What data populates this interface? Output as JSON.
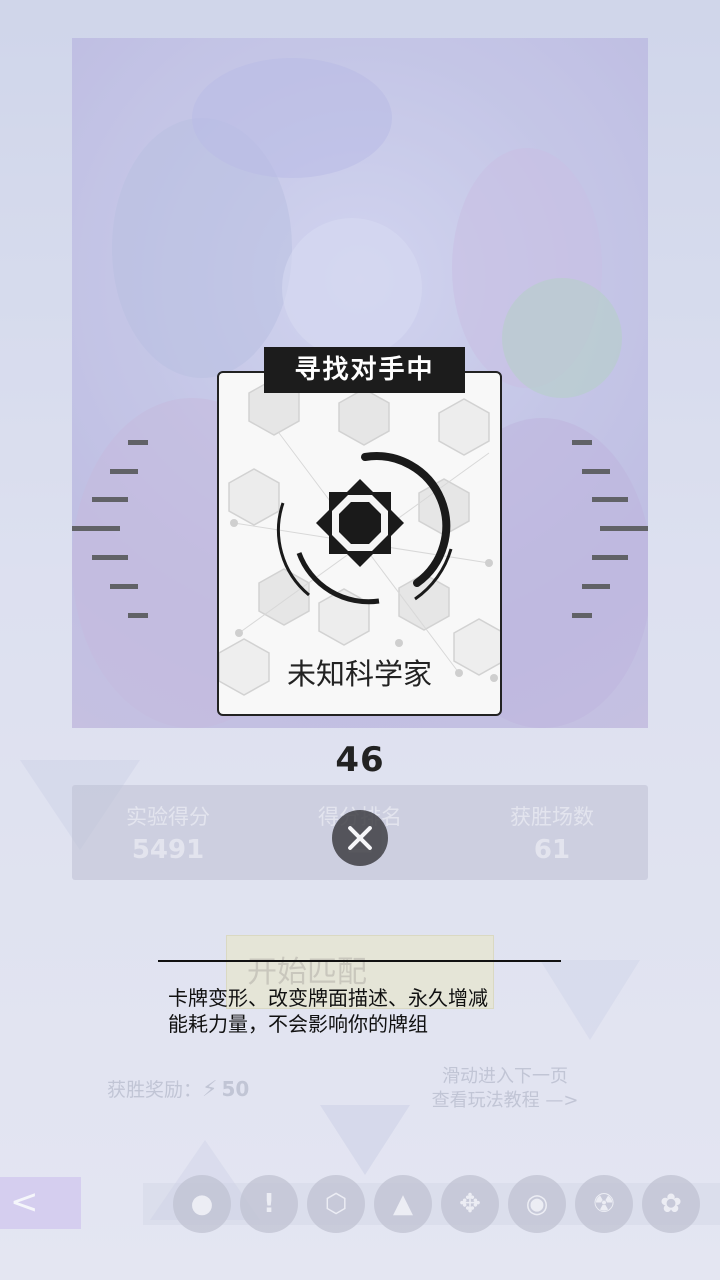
{
  "matching": {
    "title": "寻找对手中",
    "card_name": "未知科学家",
    "countdown": "46"
  },
  "stats": [
    {
      "label": "实验得分",
      "value": "5491"
    },
    {
      "label": "得分排名",
      "value": "—"
    },
    {
      "label": "获胜场数",
      "value": "61"
    }
  ],
  "start_button": {
    "label": "开始匹配"
  },
  "description": {
    "line1": "卡牌变形、改变牌面描述、永久增减",
    "line2": "能耗力量，不会影响你的牌组"
  },
  "reward": {
    "label": "获胜奖励：",
    "value": "50",
    "icon": "lightning-icon"
  },
  "slide_hint": {
    "line1": "滑动进入下一页",
    "line2": "查看玩法教程 —>"
  },
  "nav": {
    "back": "<",
    "tabs": [
      {
        "name": "bomb-icon",
        "glyph": "●"
      },
      {
        "name": "exclamation-icon",
        "glyph": "!"
      },
      {
        "name": "cube-icon",
        "glyph": "⬡"
      },
      {
        "name": "triangle-icon",
        "glyph": "▲"
      },
      {
        "name": "arrows-icon",
        "glyph": "✥"
      },
      {
        "name": "circle-dots-icon",
        "glyph": "◉"
      },
      {
        "name": "radiation-icon",
        "glyph": "☢"
      },
      {
        "name": "flower-icon",
        "glyph": "✿"
      }
    ]
  }
}
